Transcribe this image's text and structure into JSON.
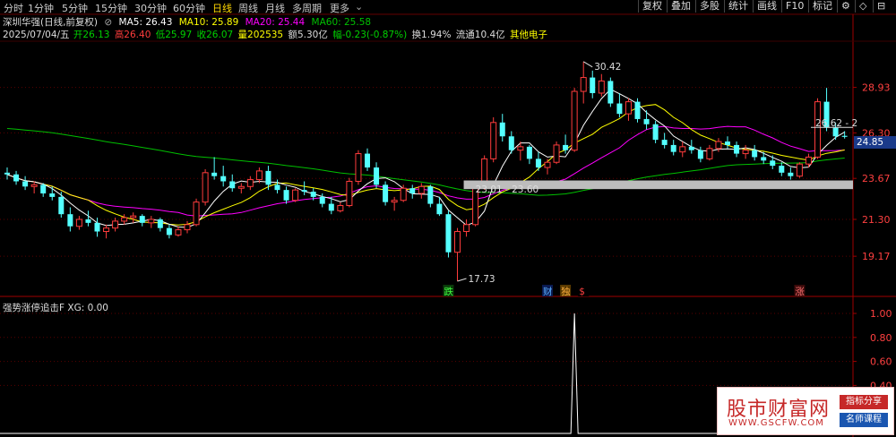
{
  "toolbar": {
    "periods": [
      "分时",
      "1分钟",
      "5分钟",
      "15分钟",
      "30分钟",
      "60分钟",
      "日线",
      "周线",
      "月线",
      "多周期",
      "更多"
    ],
    "active_period": "日线",
    "buttons": [
      "复权",
      "叠加",
      "多股",
      "统计",
      "画线",
      "F10",
      "标记"
    ],
    "window_controls": [
      "⚙",
      "◇",
      "⊟"
    ]
  },
  "info": {
    "title": "深圳华强(日线,前复权)",
    "ma5": "MA5: 26.43",
    "ma10": "MA10: 25.89",
    "ma20": "MA20: 25.44",
    "ma60": "MA60: 25.58",
    "date": "2025/07/04/五",
    "open": "开26.13",
    "high": "高26.40",
    "low": "低25.97",
    "close": "收26.07",
    "volume": "量202535",
    "amount": "额5.30亿",
    "change": "幅-0.23(-0.87%)",
    "turnover": "换1.94%",
    "float_cap": "流通10.4亿",
    "sector": "其他电子"
  },
  "colors": {
    "up": "#ff3c3c",
    "down": "#54ffff",
    "ma5": "#ffffff",
    "ma10": "#ffff00",
    "ma20": "#ff00ff",
    "ma60": "#00c000"
  },
  "y_axis_labels": [
    "28.93",
    "26.30",
    "23.67",
    "21.30",
    "19.17"
  ],
  "current_price": "24.85",
  "annotations": {
    "high": "30.42",
    "low": "17.73",
    "range": "23.01 - 23.60",
    "recent": "26.62 - 2"
  },
  "markers": [
    "跌",
    "财",
    "独",
    "$",
    "涨"
  ],
  "sub_chart": {
    "title": "强势涨停追击F  XG: 0.00",
    "y_labels": [
      "1.00",
      "0.80",
      "0.60",
      "0.40"
    ]
  },
  "watermark": {
    "main": "股市财富网",
    "url": "WWW.GSCFW.COM",
    "tag1": "指标分享",
    "tag2": "名师课程"
  },
  "chart_data": {
    "type": "candlestick",
    "candles": [
      [
        24.0,
        24.3,
        23.6,
        23.9
      ],
      [
        23.9,
        24.1,
        23.3,
        23.5
      ],
      [
        23.5,
        23.8,
        23.0,
        23.2
      ],
      [
        23.2,
        23.5,
        22.8,
        23.3
      ],
      [
        23.3,
        23.4,
        22.6,
        22.8
      ],
      [
        22.8,
        23.2,
        22.4,
        22.6
      ],
      [
        22.6,
        22.9,
        21.4,
        21.6
      ],
      [
        21.6,
        22.0,
        20.6,
        20.9
      ],
      [
        20.9,
        21.5,
        20.7,
        21.3
      ],
      [
        21.3,
        21.8,
        20.9,
        21.1
      ],
      [
        21.1,
        21.4,
        20.3,
        20.6
      ],
      [
        20.6,
        21.0,
        20.2,
        20.8
      ],
      [
        20.8,
        21.4,
        20.6,
        21.2
      ],
      [
        21.2,
        21.6,
        21.0,
        21.4
      ],
      [
        21.4,
        21.7,
        21.1,
        21.5
      ],
      [
        21.5,
        21.6,
        20.9,
        21.1
      ],
      [
        21.1,
        21.5,
        20.8,
        21.3
      ],
      [
        21.3,
        21.4,
        20.6,
        20.8
      ],
      [
        20.8,
        21.0,
        20.2,
        20.4
      ],
      [
        20.4,
        20.9,
        20.3,
        20.7
      ],
      [
        20.7,
        21.2,
        20.5,
        21.0
      ],
      [
        21.0,
        22.5,
        20.9,
        22.3
      ],
      [
        22.3,
        24.2,
        22.1,
        24.0
      ],
      [
        24.0,
        24.9,
        23.6,
        23.8
      ],
      [
        23.8,
        24.4,
        23.2,
        23.5
      ],
      [
        23.5,
        23.9,
        22.9,
        23.1
      ],
      [
        23.1,
        23.4,
        22.8,
        23.2
      ],
      [
        23.2,
        23.8,
        23.0,
        23.6
      ],
      [
        23.6,
        24.3,
        23.4,
        24.1
      ],
      [
        24.1,
        24.4,
        23.0,
        23.3
      ],
      [
        23.3,
        23.6,
        22.8,
        23.0
      ],
      [
        23.0,
        23.2,
        22.2,
        22.4
      ],
      [
        22.4,
        23.1,
        22.3,
        23.0
      ],
      [
        23.0,
        23.5,
        22.7,
        22.9
      ],
      [
        22.9,
        23.1,
        22.4,
        22.6
      ],
      [
        22.6,
        22.8,
        22.0,
        22.2
      ],
      [
        22.2,
        22.6,
        21.6,
        21.8
      ],
      [
        21.8,
        22.3,
        21.7,
        22.1
      ],
      [
        22.1,
        23.7,
        22.0,
        23.5
      ],
      [
        23.5,
        25.3,
        23.3,
        25.1
      ],
      [
        25.1,
        25.4,
        24.1,
        24.3
      ],
      [
        24.3,
        24.6,
        23.1,
        23.3
      ],
      [
        23.3,
        23.5,
        22.1,
        22.3
      ],
      [
        22.3,
        22.6,
        21.8,
        22.4
      ],
      [
        22.4,
        23.3,
        22.3,
        23.1
      ],
      [
        23.1,
        23.3,
        22.5,
        22.8
      ],
      [
        22.8,
        23.4,
        22.5,
        23.2
      ],
      [
        23.2,
        23.3,
        22.0,
        22.2
      ],
      [
        22.2,
        22.6,
        21.5,
        21.6
      ],
      [
        21.6,
        21.8,
        19.1,
        19.4
      ],
      [
        19.4,
        20.8,
        17.73,
        20.6
      ],
      [
        20.6,
        21.3,
        20.3,
        21.0
      ],
      [
        21.0,
        23.3,
        20.9,
        23.1
      ],
      [
        23.1,
        25.0,
        23.0,
        24.8
      ],
      [
        24.8,
        27.2,
        24.6,
        26.9
      ],
      [
        26.9,
        27.4,
        25.8,
        26.1
      ],
      [
        26.1,
        26.4,
        25.1,
        25.3
      ],
      [
        25.3,
        25.8,
        24.7,
        25.5
      ],
      [
        25.5,
        25.6,
        24.5,
        24.8
      ],
      [
        24.8,
        25.2,
        24.1,
        24.3
      ],
      [
        24.3,
        24.8,
        23.9,
        24.6
      ],
      [
        24.6,
        25.8,
        24.5,
        25.6
      ],
      [
        25.6,
        26.2,
        25.1,
        25.3
      ],
      [
        25.3,
        28.9,
        25.2,
        28.7
      ],
      [
        28.7,
        30.42,
        28.0,
        29.5
      ],
      [
        29.5,
        29.9,
        28.3,
        28.6
      ],
      [
        28.6,
        29.7,
        28.4,
        29.3
      ],
      [
        29.3,
        29.5,
        27.8,
        28.0
      ],
      [
        28.0,
        28.6,
        27.2,
        27.4
      ],
      [
        27.4,
        28.3,
        27.0,
        28.1
      ],
      [
        28.1,
        28.3,
        26.9,
        27.1
      ],
      [
        27.1,
        27.6,
        26.5,
        26.8
      ],
      [
        26.8,
        27.0,
        25.7,
        25.9
      ],
      [
        25.9,
        26.3,
        25.4,
        25.6
      ],
      [
        25.6,
        25.9,
        25.0,
        25.2
      ],
      [
        25.2,
        25.8,
        24.9,
        25.5
      ],
      [
        25.5,
        25.9,
        25.1,
        25.3
      ],
      [
        25.3,
        25.5,
        24.6,
        24.8
      ],
      [
        24.8,
        25.6,
        24.7,
        25.4
      ],
      [
        25.4,
        26.0,
        25.2,
        25.8
      ],
      [
        25.8,
        26.1,
        25.4,
        25.6
      ],
      [
        25.6,
        25.8,
        24.9,
        25.1
      ],
      [
        25.1,
        25.6,
        24.8,
        25.3
      ],
      [
        25.3,
        25.6,
        24.7,
        24.9
      ],
      [
        24.9,
        25.2,
        24.5,
        24.7
      ],
      [
        24.7,
        25.0,
        24.2,
        24.4
      ],
      [
        24.4,
        24.6,
        23.8,
        24.0
      ],
      [
        24.0,
        24.3,
        23.6,
        23.8
      ],
      [
        23.8,
        24.6,
        23.7,
        24.5
      ],
      [
        24.5,
        25.1,
        24.3,
        24.9
      ],
      [
        24.9,
        28.3,
        24.8,
        28.1
      ],
      [
        28.1,
        28.9,
        26.4,
        26.6
      ],
      [
        26.6,
        26.9,
        25.9,
        26.1
      ],
      [
        26.13,
        26.4,
        25.97,
        26.07
      ]
    ],
    "xg_signal_index": 63
  }
}
